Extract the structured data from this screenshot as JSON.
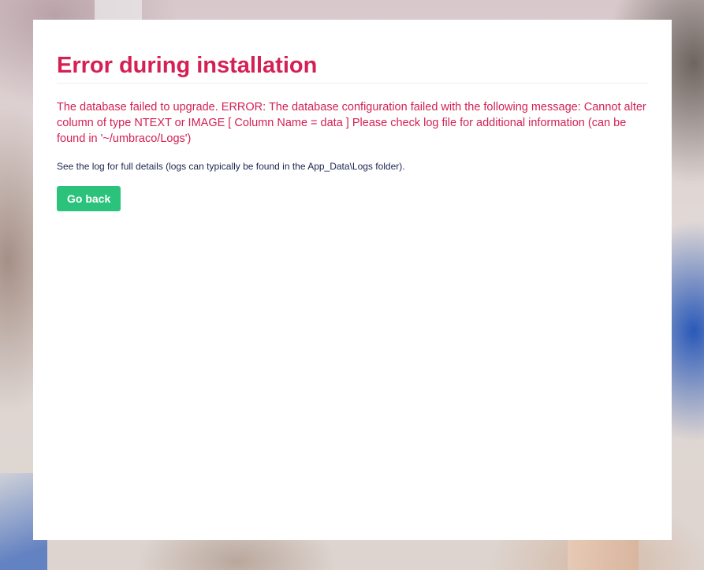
{
  "page": {
    "title": "Error during installation",
    "error_message": "The database failed to upgrade. ERROR: The database configuration failed with the following message: Cannot alter column of type NTEXT or IMAGE [ Column Name = data ] Please check log file for additional information (can be found in '~/umbraco/Logs')",
    "detail_note": "See the log for full details (logs can typically be found in the App_Data\\Logs folder).",
    "go_back_label": "Go back"
  },
  "colors": {
    "error_red": "#d42054",
    "button_green": "#2bc37c",
    "text_navy": "#1b264f",
    "panel_white": "#ffffff"
  }
}
